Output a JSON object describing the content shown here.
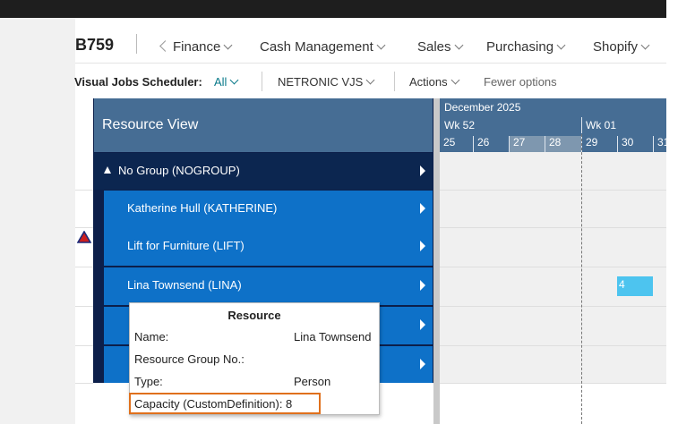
{
  "app": {
    "company": "B759"
  },
  "nav": {
    "back_glyph": "chevron-left-icon",
    "items": [
      {
        "label": "Finance"
      },
      {
        "label": "Cash Management"
      },
      {
        "label": "Sales"
      },
      {
        "label": "Purchasing"
      },
      {
        "label": "Shopify"
      }
    ]
  },
  "toolbar": {
    "vjs_label": "Visual Jobs Scheduler:",
    "vjs_filter": "All",
    "netronic": "NETRONIC VJS",
    "actions": "Actions",
    "fewer_options": "Fewer options"
  },
  "resource_view": {
    "title": "Resource View",
    "group": {
      "label": "No Group (NOGROUP)"
    },
    "rows": [
      {
        "label": "Katherine Hull (KATHERINE)"
      },
      {
        "label": "Lift for Furniture (LIFT)"
      },
      {
        "label": "Lina Townsend (LINA)"
      },
      {
        "label": ""
      },
      {
        "label": ""
      }
    ]
  },
  "gantt": {
    "month": "December 2025",
    "weeks": [
      "Wk 52",
      "Wk 01"
    ],
    "days": [
      "25",
      "26",
      "27",
      "28",
      "29",
      "30",
      "31"
    ],
    "weekend_days": [
      "27",
      "28"
    ],
    "task_label": "4"
  },
  "tooltip": {
    "title": "Resource",
    "fields": [
      {
        "label": "Name:",
        "value": "Lina Townsend"
      },
      {
        "label": "Resource Group No.:",
        "value": ""
      },
      {
        "label": "Type:",
        "value": "Person"
      },
      {
        "label": "Capacity (CustomDefinition): 8",
        "value": ""
      }
    ]
  },
  "colors": {
    "header_blue": "#466d94",
    "row_blue": "#0e71c8",
    "group_navy": "#0c2650",
    "task_cyan": "#4dc4ef",
    "highlight_orange": "#e0701c",
    "filter_teal": "#0a7a8a"
  }
}
